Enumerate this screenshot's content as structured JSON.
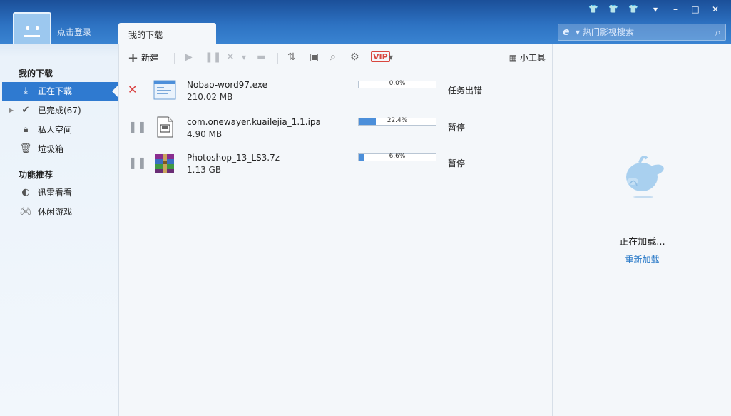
{
  "header": {
    "login_label": "点击登录",
    "active_tab": "我的下载",
    "search_placeholder": "热门影视搜索"
  },
  "window_controls": [
    "▾",
    "–",
    "□",
    "✕"
  ],
  "sidebar": {
    "section1_title": "我的下载",
    "items": [
      {
        "label": "正在下载",
        "icon": "download-icon"
      },
      {
        "label": "已完成(67)",
        "icon": "check-icon"
      },
      {
        "label": "私人空间",
        "icon": "lock-icon"
      },
      {
        "label": "垃圾箱",
        "icon": "trash-icon"
      }
    ],
    "section2_title": "功能推荐",
    "items2": [
      {
        "label": "迅雷看看",
        "icon": "xunlei-kankan-icon"
      },
      {
        "label": "休闲游戏",
        "icon": "gamepad-icon"
      }
    ]
  },
  "toolbar": {
    "new_label": "新建",
    "tools_label": "小工具",
    "vip_label": "VIP"
  },
  "downloads": [
    {
      "name": "Nobao-word97.exe",
      "size": "210.02 MB",
      "progress": 0.0,
      "progress_text": "0.0%",
      "status": "任务出错",
      "action": "error",
      "icon": "exe-window-icon"
    },
    {
      "name": "com.onewayer.kuailejia_1.1.ipa",
      "size": "4.90 MB",
      "progress": 22.4,
      "progress_text": "22.4%",
      "status": "暂停",
      "action": "pause",
      "icon": "ipa-file-icon"
    },
    {
      "name": "Photoshop_13_LS3.7z",
      "size": "1.13 GB",
      "progress": 6.6,
      "progress_text": "6.6%",
      "status": "暂停",
      "action": "pause",
      "icon": "winrar-archive-icon"
    }
  ],
  "right_panel": {
    "loading_text": "正在加载...",
    "reload_label": "重新加载"
  },
  "colors": {
    "accent": "#2f7ad0",
    "progress": "#4c8fda",
    "error": "#d94040",
    "link": "#2a7ac8"
  }
}
